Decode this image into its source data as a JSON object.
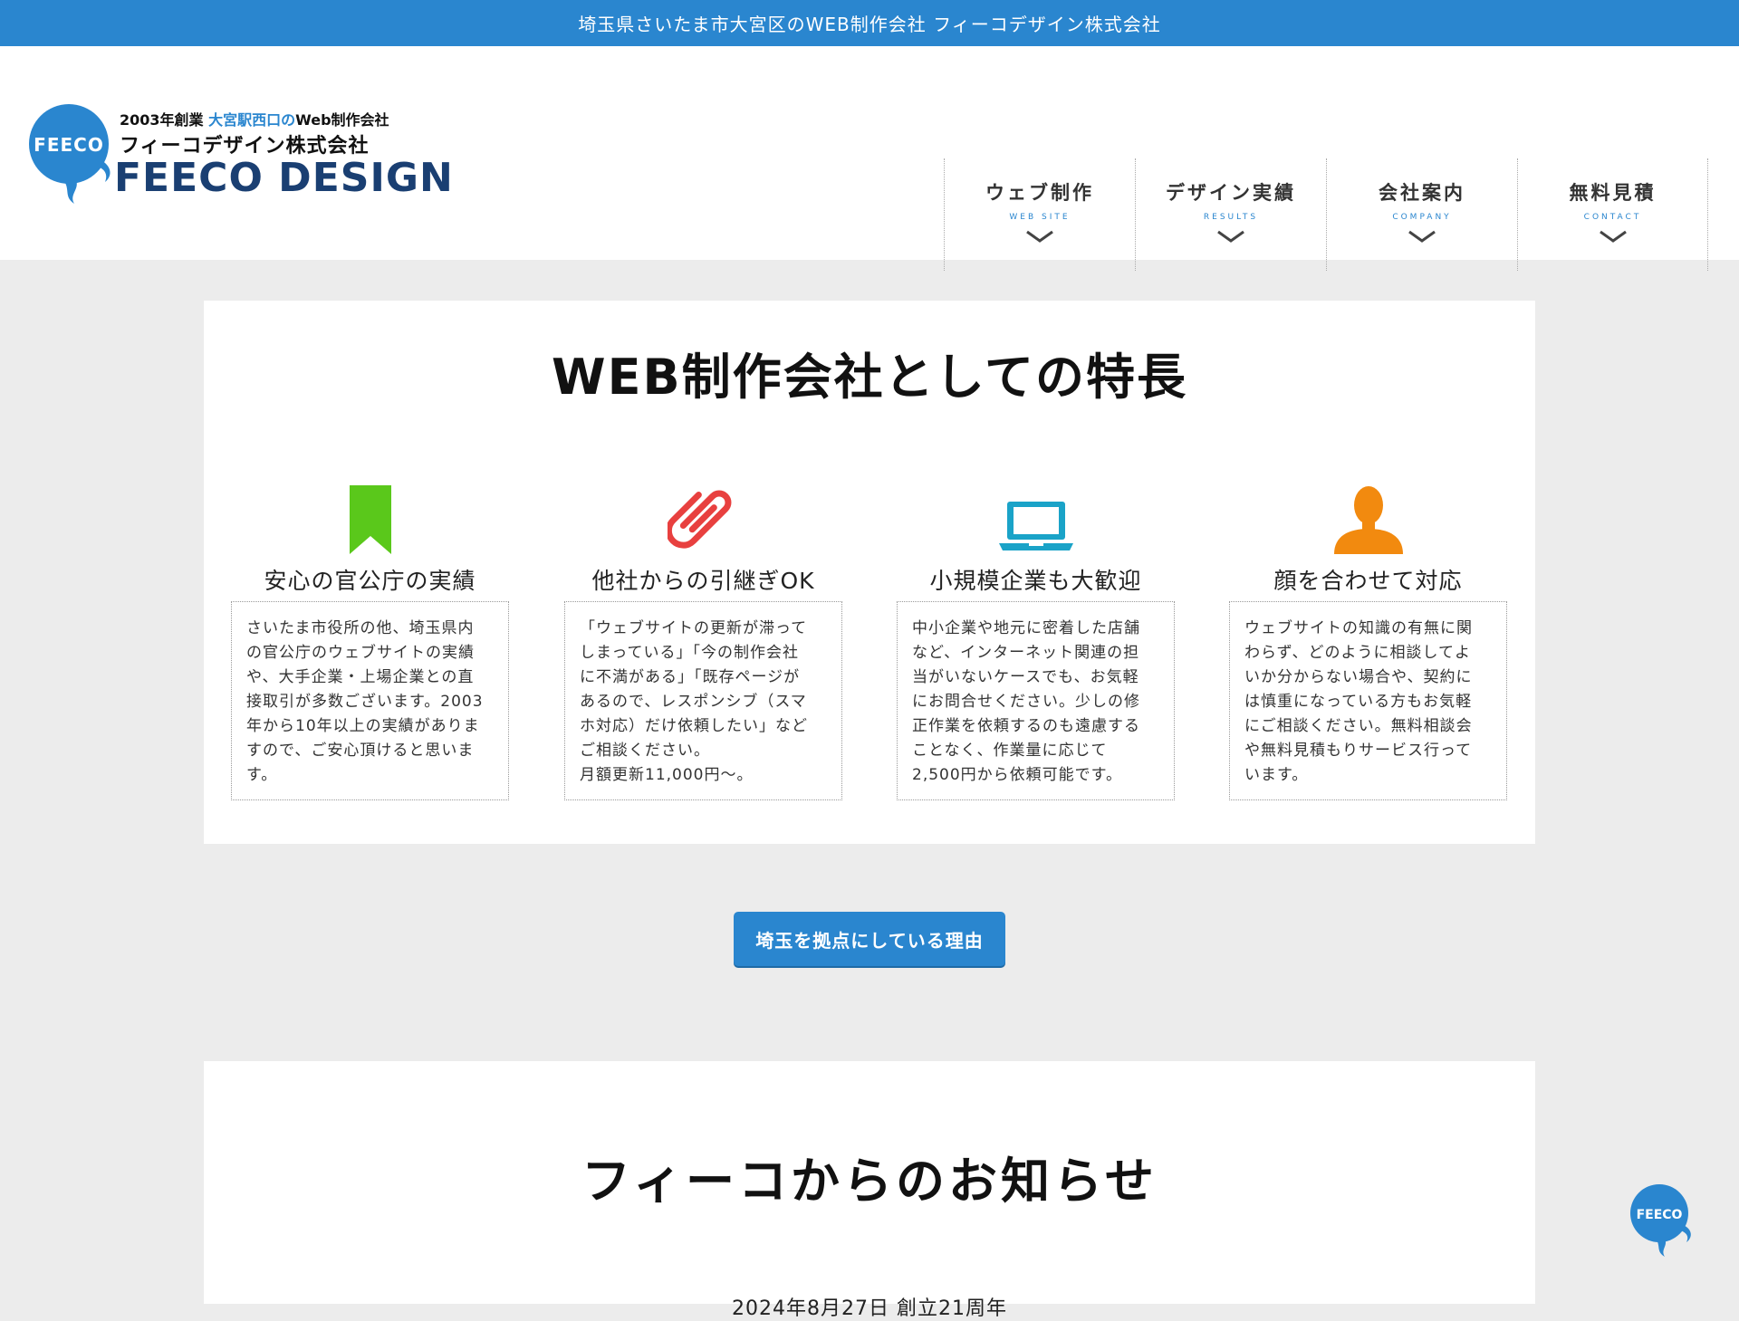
{
  "topbar": {
    "text": "埼玉県さいたま市大宮区のWEB制作会社 フィーコデザイン株式会社"
  },
  "logo": {
    "badge_text": "FEECO",
    "line1_prefix": "2003年創業",
    "line1_highlight": "大宮駅西口の",
    "line1_suffix": "Web制作会社",
    "line2": "フィーコデザイン株式会社",
    "line3": "FEECO DESIGN"
  },
  "nav": [
    {
      "jp": "ウェブ制作",
      "en": "WEB SITE"
    },
    {
      "jp": "デザイン実績",
      "en": "RESULTS"
    },
    {
      "jp": "会社案内",
      "en": "COMPANY"
    },
    {
      "jp": "無料見積",
      "en": "CONTACT"
    }
  ],
  "features": {
    "title": "WEB制作会社としての特長",
    "items": [
      {
        "icon": "bookmark-icon",
        "color": "#5ac81b",
        "title": "安心の官公庁の実績",
        "text": "さいたま市役所の他、埼玉県内\nの官公庁のウェブサイトの実績\nや、大手企業・上場企業との直\n接取引が多数ございます。2003\n年から10年以上の実績がありま\nすので、ご安心頂けると思いま\nす。"
      },
      {
        "icon": "paperclip-icon",
        "color": "#e8403f",
        "title": "他社からの引継ぎOK",
        "text": "「ウェブサイトの更新が滞って\nしまっている」「今の制作会社\nに不満がある」「既存ページが\nあるので、レスポンシブ（スマ\nホ対応）だけ依頼したい」など\nご相談ください。\n月額更新11,000円〜。"
      },
      {
        "icon": "laptop-icon",
        "color": "#1aa3c8",
        "title": "小規模企業も大歓迎",
        "text": "中小企業や地元に密着した店舗\nなど、インターネット関連の担\n当がいないケースでも、お気軽\nにお問合せください。少しの修\n正作業を依頼するのも遠慮する\nことなく、作業量に応じて\n2,500円から依頼可能です。"
      },
      {
        "icon": "person-icon",
        "color": "#f28a0f",
        "title": "顔を合わせて対応",
        "text": "ウェブサイトの知識の有無に関\nわらず、どのように相談してよ\nいか分からない場合や、契約に\nは慎重になっている方もお気軽\nにご相談ください。無料相談会\nや無料見積もりサービス行って\nいます。"
      }
    ]
  },
  "reason_button": {
    "label": "埼玉を拠点にしている理由"
  },
  "news": {
    "title": "フィーコからのお知らせ",
    "item": "2024年8月27日 創立21周年"
  },
  "float_badge": {
    "text": "FEECO"
  },
  "colors": {
    "accent": "#2a86cf",
    "logo_navy": "#1a3f72",
    "background": "#ececec"
  }
}
